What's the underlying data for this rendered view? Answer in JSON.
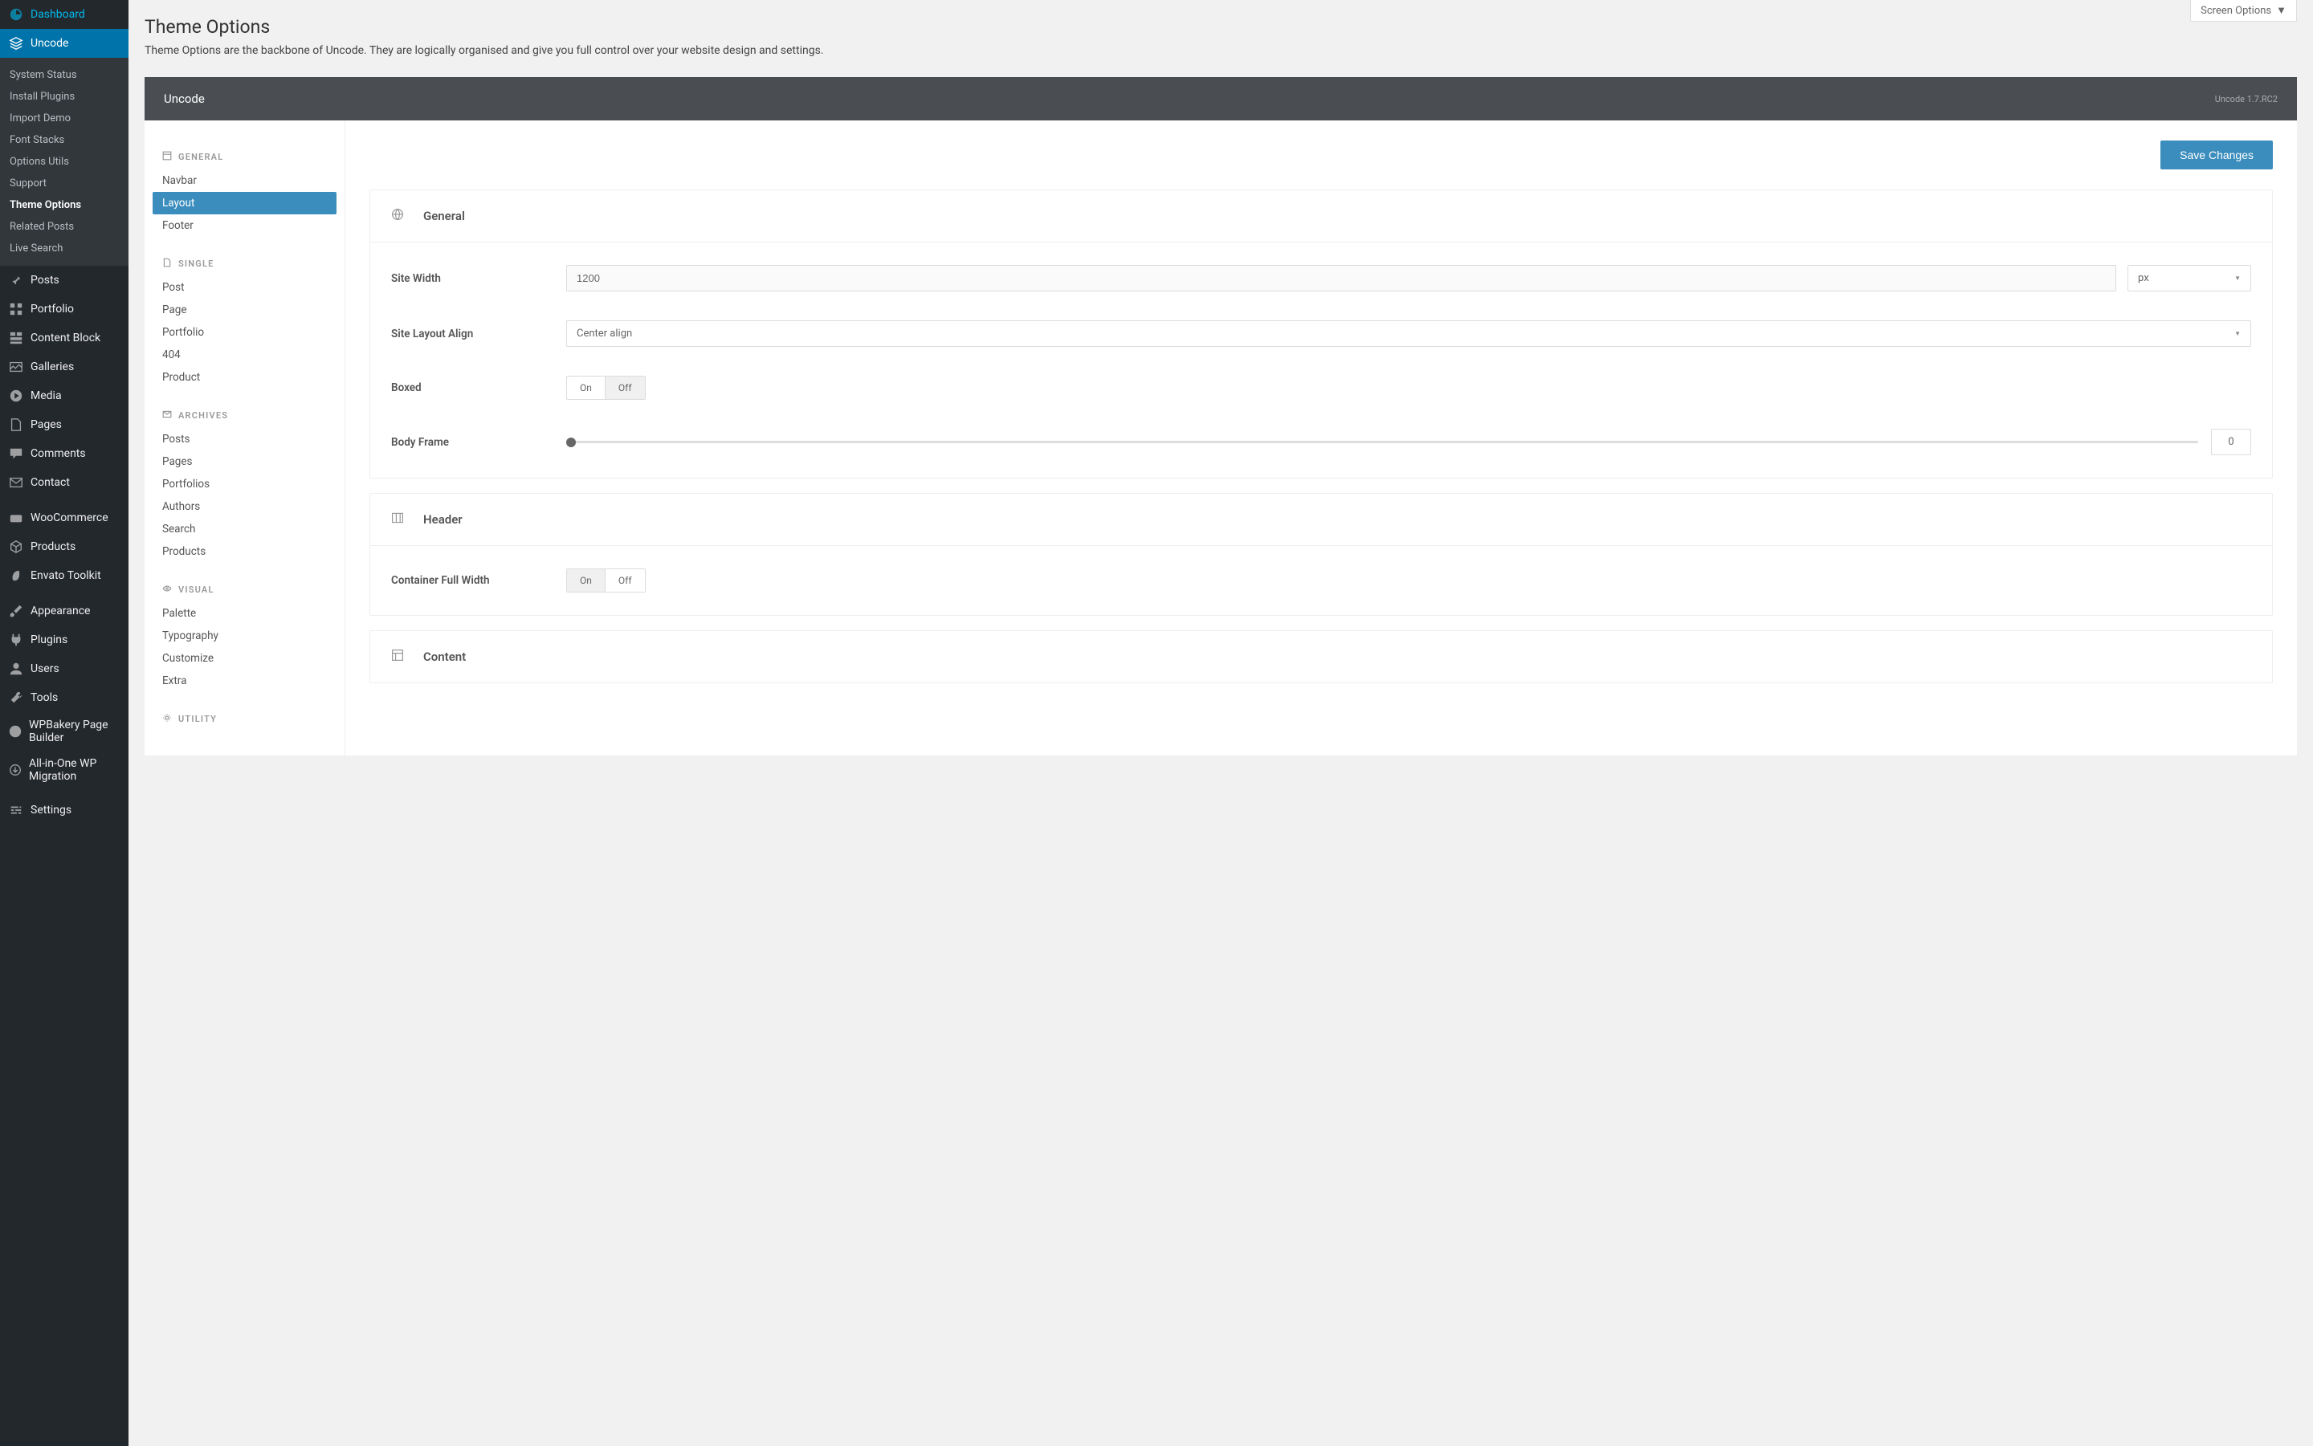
{
  "screenOptions": "Screen Options",
  "page": {
    "title": "Theme Options",
    "desc": "Theme Options are the backbone of Uncode. They are logically organised and give you full control over your website design and settings."
  },
  "sidebar": {
    "items": [
      {
        "label": "Dashboard"
      },
      {
        "label": "Uncode"
      },
      {
        "label": "Posts"
      },
      {
        "label": "Portfolio"
      },
      {
        "label": "Content Block"
      },
      {
        "label": "Galleries"
      },
      {
        "label": "Media"
      },
      {
        "label": "Pages"
      },
      {
        "label": "Comments"
      },
      {
        "label": "Contact"
      },
      {
        "label": "WooCommerce"
      },
      {
        "label": "Products"
      },
      {
        "label": "Envato Toolkit"
      },
      {
        "label": "Appearance"
      },
      {
        "label": "Plugins"
      },
      {
        "label": "Users"
      },
      {
        "label": "Tools"
      },
      {
        "label": "WPBakery Page Builder"
      },
      {
        "label": "All-in-One WP Migration"
      },
      {
        "label": "Settings"
      }
    ],
    "submenu": [
      "System Status",
      "Install Plugins",
      "Import Demo",
      "Font Stacks",
      "Options Utils",
      "Support",
      "Theme Options",
      "Related Posts",
      "Live Search"
    ]
  },
  "panel": {
    "title": "Uncode",
    "version": "Uncode 1.7.RC2",
    "save": "Save Changes"
  },
  "nav": {
    "groups": {
      "general": {
        "hd": "General",
        "items": [
          "Navbar",
          "Layout",
          "Footer"
        ]
      },
      "single": {
        "hd": "Single",
        "items": [
          "Post",
          "Page",
          "Portfolio",
          "404",
          "Product"
        ]
      },
      "archives": {
        "hd": "Archives",
        "items": [
          "Posts",
          "Pages",
          "Portfolios",
          "Authors",
          "Search",
          "Products"
        ]
      },
      "visual": {
        "hd": "Visual",
        "items": [
          "Palette",
          "Typography",
          "Customize",
          "Extra"
        ]
      },
      "utility": {
        "hd": "Utility"
      }
    }
  },
  "sections": {
    "general": {
      "title": "General",
      "siteWidth": {
        "label": "Site Width",
        "value": "1200",
        "unit": "px"
      },
      "layoutAlign": {
        "label": "Site Layout Align",
        "value": "Center align"
      },
      "boxed": {
        "label": "Boxed",
        "on": "On",
        "off": "Off",
        "value": "Off"
      },
      "bodyFrame": {
        "label": "Body Frame",
        "value": "0"
      }
    },
    "header": {
      "title": "Header",
      "containerFull": {
        "label": "Container Full Width",
        "on": "On",
        "off": "Off",
        "value": "On"
      }
    },
    "content": {
      "title": "Content"
    }
  }
}
